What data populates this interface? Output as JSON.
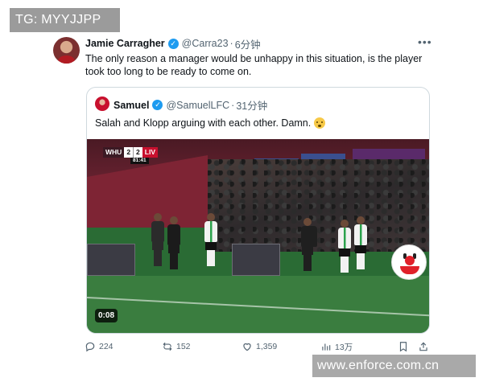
{
  "watermarks": {
    "top": "TG: MYYJJPP",
    "bottom": "www.enforce.com.cn"
  },
  "tweet": {
    "author_name": "Jamie Carragher",
    "handle": "@Carra23",
    "separator": "·",
    "time": "6分钟",
    "text": "The only reason a manager would be unhappy in this situation, is the player took too long to be ready to come on."
  },
  "quote": {
    "author_name": "Samuel",
    "handle": "@SamuelLFC",
    "separator": "·",
    "time": "31分钟",
    "text": "Salah and Klopp arguing with each other. Damn.",
    "media": {
      "duration": "0:08",
      "scorebug": {
        "home": "WHU",
        "home_score": "2",
        "away_score": "2",
        "away": "LIV",
        "clock": "81:41"
      }
    }
  },
  "actions": {
    "replies": "224",
    "reposts": "152",
    "likes": "1,359",
    "views": "13万"
  },
  "colors": {
    "accent": "#1d9bf0",
    "muted": "#536471",
    "border": "#cfd9de"
  }
}
